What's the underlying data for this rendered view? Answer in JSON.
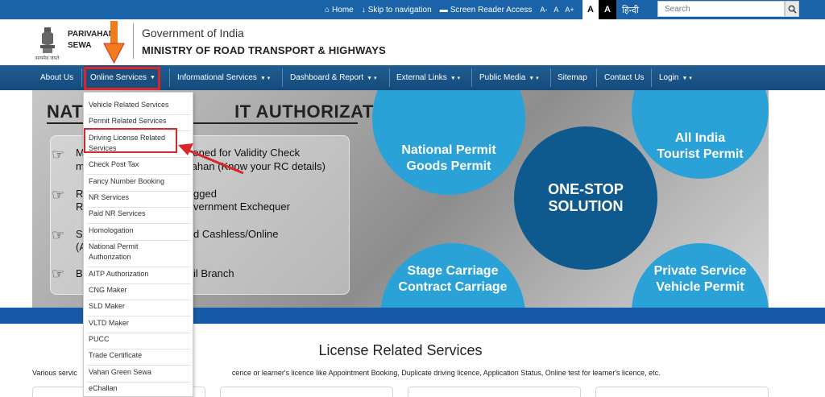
{
  "topbar": {
    "home": "Home",
    "skip": "Skip to navigation",
    "screen_reader": "Screen Reader Access",
    "font_small": "A-",
    "font_normal": "A",
    "font_large": "A+",
    "contrast_white": "A",
    "contrast_black": "A",
    "language": "हिन्दी",
    "search_placeholder": "Search"
  },
  "header": {
    "brand_line1": "PARIVAHAN",
    "brand_line2": "SEWA",
    "emblem_motto": "सत्यमेव जयते",
    "gov": "Government of India",
    "ministry": "MINISTRY OF ROAD TRANSPORT & HIGHWAYS"
  },
  "nav": {
    "items": [
      {
        "label": "About Us"
      },
      {
        "label": "Online Services"
      },
      {
        "label": "Informational Services"
      },
      {
        "label": "Dashboard & Report"
      },
      {
        "label": "External Links"
      },
      {
        "label": "Public Media"
      },
      {
        "label": "Sitemap"
      },
      {
        "label": "Contact Us"
      },
      {
        "label": "Login"
      }
    ]
  },
  "dropdown": {
    "items": [
      "Vehicle Related Services",
      "Permit Related Services",
      "Driving License Related",
      "Services",
      "Check Post Tax",
      "Fancy Number Booking",
      "NR Services",
      "Paid NR Services",
      "Homologation",
      "National Permit",
      "Authorization",
      "AITP Authorization",
      "CNG Maker",
      "SLD Maker",
      "VLTD Maker",
      "PUCC",
      "Trade Certificate",
      "Vahan Green Sewa",
      "eChallan"
    ]
  },
  "banner": {
    "title_part1": "NAT",
    "title_part2": "IT AUTHORIZATION",
    "lines": [
      "M",
      "sioned for Validity Check",
      "m",
      "Vahan (Know your RC details)",
      "R",
      "gged",
      "R",
      "vernment Exchequer",
      "S",
      "d Cashless/Online",
      "(A",
      "B",
      "il Branch"
    ],
    "circles": {
      "goods": [
        "National Permit",
        "Goods Permit"
      ],
      "tourist": [
        "All India",
        "Tourist Permit"
      ],
      "onestop": [
        "ONE-STOP",
        "SOLUTION"
      ],
      "stage": [
        "Stage Carriage",
        "Contract Carriage"
      ],
      "private": [
        "Private Service",
        "Vehicle Permit"
      ]
    }
  },
  "section": {
    "title": "License Related Services",
    "desc_start": "Various servic",
    "desc_end": "cence or learner's licence like Appointment Booking, Duplicate driving licence, Application Status, Online test for learner's licence, etc."
  },
  "colors": {
    "topbar": "#1b63a9",
    "nav": "#1f5d93",
    "highlight": "#d9262a",
    "circle": "#2aa2d8",
    "circle_dark": "#0e5a8e",
    "arrow_orange": "#f07c1c"
  }
}
